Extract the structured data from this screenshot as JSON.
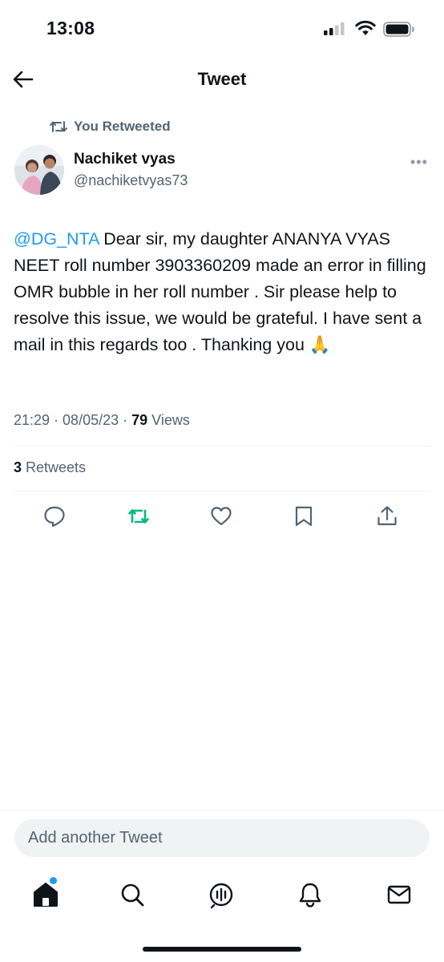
{
  "status_bar": {
    "time": "13:08"
  },
  "header": {
    "title": "Tweet"
  },
  "retweet_context": {
    "text": "You Retweeted"
  },
  "author": {
    "name": "Nachiket vyas",
    "handle": "@nachiketvyas73"
  },
  "tweet": {
    "mention": "@DG_NTA",
    "text": " Dear sir, my daughter ANANYA VYAS NEET roll number 3903360209 made an error in filling OMR bubble in her roll number . Sir please help to resolve this issue, we would be grateful. I have sent a mail in this regards too . Thanking you ",
    "emoji": "🙏"
  },
  "meta": {
    "time": "21:29",
    "date": "08/05/23",
    "views_count": "79",
    "views_label": " Views"
  },
  "stats": {
    "retweets_count": "3",
    "retweets_label": " Retweets"
  },
  "actions": [
    "reply-icon",
    "retweet-icon",
    "like-icon",
    "bookmark-icon",
    "share-icon"
  ],
  "compose": {
    "placeholder": "Add another Tweet"
  },
  "tab_bar": [
    "home-icon",
    "search-icon",
    "spaces-icon",
    "notifications-icon",
    "messages-icon"
  ],
  "colors": {
    "accent": "#1d9bf0",
    "retweet_active": "#00ba7c",
    "secondary_text": "#536471"
  }
}
